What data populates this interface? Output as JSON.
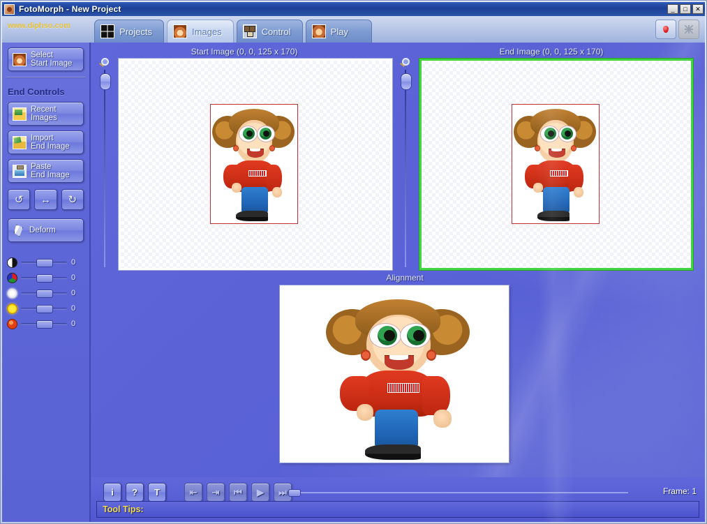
{
  "window": {
    "title": "FotoMorph - New Project",
    "icon": "app-portrait-icon",
    "minimize_label": "_",
    "maximize_label": "□",
    "close_label": "✕"
  },
  "header": {
    "brand": "www.diphso.com",
    "tabs": [
      {
        "label": "Projects",
        "icon": "grid-icon",
        "active": false
      },
      {
        "label": "Images",
        "icon": "portrait-icon",
        "active": true
      },
      {
        "label": "Control",
        "icon": "control-nodes-icon",
        "active": false
      },
      {
        "label": "Play",
        "icon": "play-portrait-icon",
        "active": false
      }
    ],
    "right_buttons": [
      {
        "name": "record-button",
        "icon": "red-drop-icon",
        "enabled": true
      },
      {
        "name": "settings-button",
        "icon": "gray-star-icon",
        "enabled": false
      }
    ]
  },
  "sidebar": {
    "select_start": {
      "label": "Select\nStart Image",
      "icon": "portrait-icon"
    },
    "section_title": "End Controls",
    "buttons": [
      {
        "label": "Recent\nImages",
        "icon": "folder-images-icon"
      },
      {
        "label": "Import\nEnd Image",
        "icon": "folder-import-icon"
      },
      {
        "label": "Paste\nEnd Image",
        "icon": "clipboard-paste-icon"
      }
    ],
    "transform_buttons": [
      {
        "label": "↺",
        "name": "rotate-left-button"
      },
      {
        "label": "↔",
        "name": "flip-horizontal-button"
      },
      {
        "label": "↻",
        "name": "rotate-right-button"
      }
    ],
    "deform": {
      "label": "Deform",
      "icon": "deform-icon"
    },
    "sliders": [
      {
        "name": "contrast-slider",
        "icon": "contrast-icon",
        "value": "0"
      },
      {
        "name": "color-slider",
        "icon": "color-wheel-icon",
        "value": "0"
      },
      {
        "name": "brightness-slider",
        "icon": "brightness-icon",
        "value": "0"
      },
      {
        "name": "gamma-slider",
        "icon": "sun-icon",
        "value": "0"
      },
      {
        "name": "saturation-slider",
        "icon": "red-sphere-icon",
        "value": "0"
      }
    ]
  },
  "main": {
    "start_panel_title": "Start Image (0, 0, 125 x 170)",
    "end_panel_title": "End Image (0, 0, 125 x 170)",
    "alignment_title": "Alignment",
    "start_border_color": "#ffffff",
    "end_border_color": "#43d443",
    "background_color": "#5c64d8"
  },
  "bottom": {
    "tools": [
      {
        "label": "i",
        "name": "info-button",
        "enabled": true
      },
      {
        "label": "?",
        "name": "help-button",
        "enabled": true
      },
      {
        "label": "T",
        "name": "text-button",
        "enabled": true
      }
    ],
    "transport": [
      {
        "label": "⇤",
        "name": "step-back-button",
        "enabled": false
      },
      {
        "label": "⇥",
        "name": "step-forward-button",
        "enabled": false
      },
      {
        "label": "⏮",
        "name": "skip-start-button",
        "enabled": false
      },
      {
        "label": "▶",
        "name": "play-button",
        "enabled": false
      },
      {
        "label": "⏭",
        "name": "skip-end-button",
        "enabled": false
      }
    ],
    "frame_label": "Frame: 1",
    "tooltips_label": "Tool Tips:"
  }
}
